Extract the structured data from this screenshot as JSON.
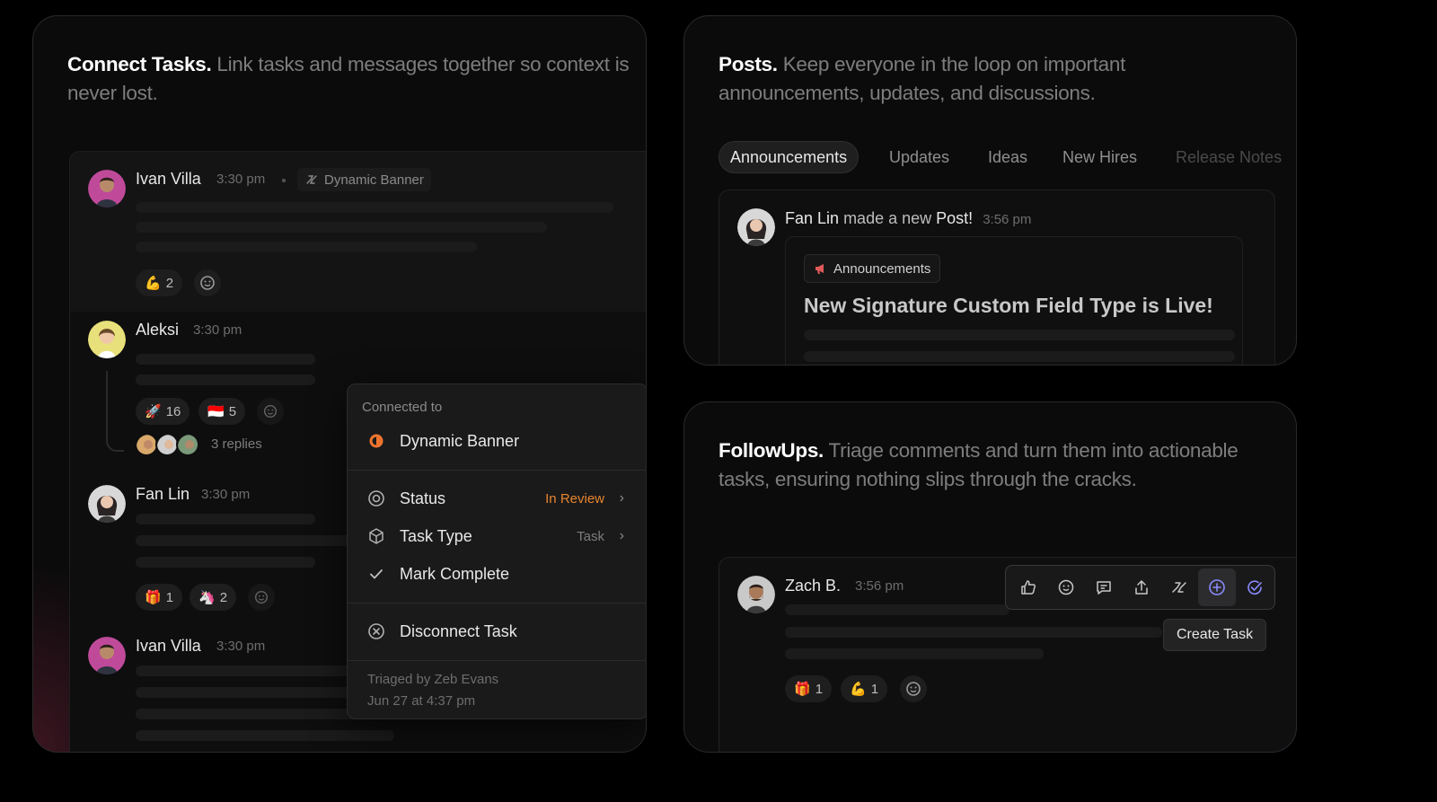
{
  "connect_card": {
    "title": "Connect Tasks.",
    "subtitle": "Link tasks and messages together so context is never lost.",
    "messages": [
      {
        "name": "Ivan Villa",
        "time": "3:30 pm",
        "task_tag": "Dynamic Banner",
        "reactions": [
          {
            "emoji": "💪",
            "count": "2"
          }
        ]
      },
      {
        "name": "Aleksi",
        "time": "3:30 pm",
        "reactions": [
          {
            "emoji": "🚀",
            "count": "16"
          },
          {
            "emoji": "🇮🇩",
            "count": "5"
          }
        ],
        "replies": "3 replies"
      },
      {
        "name": "Fan Lin",
        "time": "3:30 pm",
        "reactions": [
          {
            "emoji": "🎁",
            "count": "1"
          },
          {
            "emoji": "🦄",
            "count": "2"
          }
        ]
      },
      {
        "name": "Ivan Villa",
        "time": "3:30 pm"
      }
    ],
    "context_menu": {
      "section_label": "Connected to",
      "connected_task": "Dynamic Banner",
      "status_label": "Status",
      "status_value": "In Review",
      "task_type_label": "Task Type",
      "task_type_value": "Task",
      "mark_complete": "Mark Complete",
      "disconnect": "Disconnect Task",
      "triaged_by": "Triaged by Zeb Evans",
      "triaged_date": "Jun 27 at 4:37 pm"
    }
  },
  "posts_card": {
    "title": "Posts.",
    "subtitle": "Keep everyone in the loop on important announcements, updates, and discussions.",
    "tabs": [
      "Announcements",
      "Updates",
      "Ideas",
      "New Hires",
      "Release Notes"
    ],
    "post": {
      "author": "Fan Lin",
      "action": "made a new",
      "object": "Post!",
      "time": "3:56 pm",
      "category": "Announcements",
      "headline": "New Signature Custom Field Type is Live!"
    }
  },
  "followups_card": {
    "title": "FollowUps.",
    "subtitle": "Triage comments and turn them into actionable tasks, ensuring nothing slips through the cracks.",
    "message": {
      "name": "Zach B.",
      "time": "3:56 pm",
      "reactions": [
        {
          "emoji": "🎁",
          "count": "1"
        },
        {
          "emoji": "💪",
          "count": "1"
        }
      ]
    },
    "toolbar_icons": [
      "thumbs-up-icon",
      "add-reaction-icon",
      "comment-icon",
      "share-icon",
      "connect-task-icon",
      "create-task-icon",
      "followup-check-icon"
    ],
    "tooltip": "Create Task"
  },
  "colors": {
    "accent_orange": "#f0752e",
    "status_in_review": "#e8852c",
    "active_tool": "#8b8bff",
    "background": "#000000"
  }
}
